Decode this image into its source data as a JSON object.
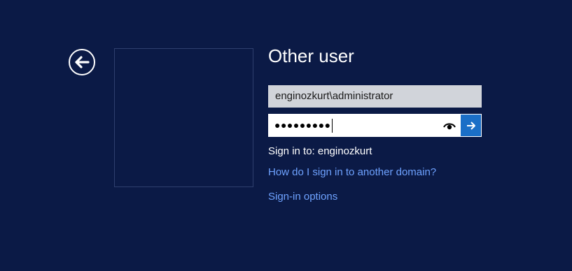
{
  "login": {
    "title": "Other user",
    "username_value": "enginozkurt\\administrator",
    "password_masked": "●●●●●●●●●",
    "sign_in_to": "Sign in to: enginozkurt",
    "domain_help_link": "How do I sign in to another domain?",
    "sign_in_options_link": "Sign-in options"
  },
  "icons": {
    "back": "back-arrow-icon",
    "reveal": "eye-icon",
    "submit": "arrow-right-icon"
  },
  "colors": {
    "background": "#0b1a46",
    "link": "#6ea2ff",
    "submit_button": "#1b6fc7",
    "username_field": "#d1d4da"
  }
}
